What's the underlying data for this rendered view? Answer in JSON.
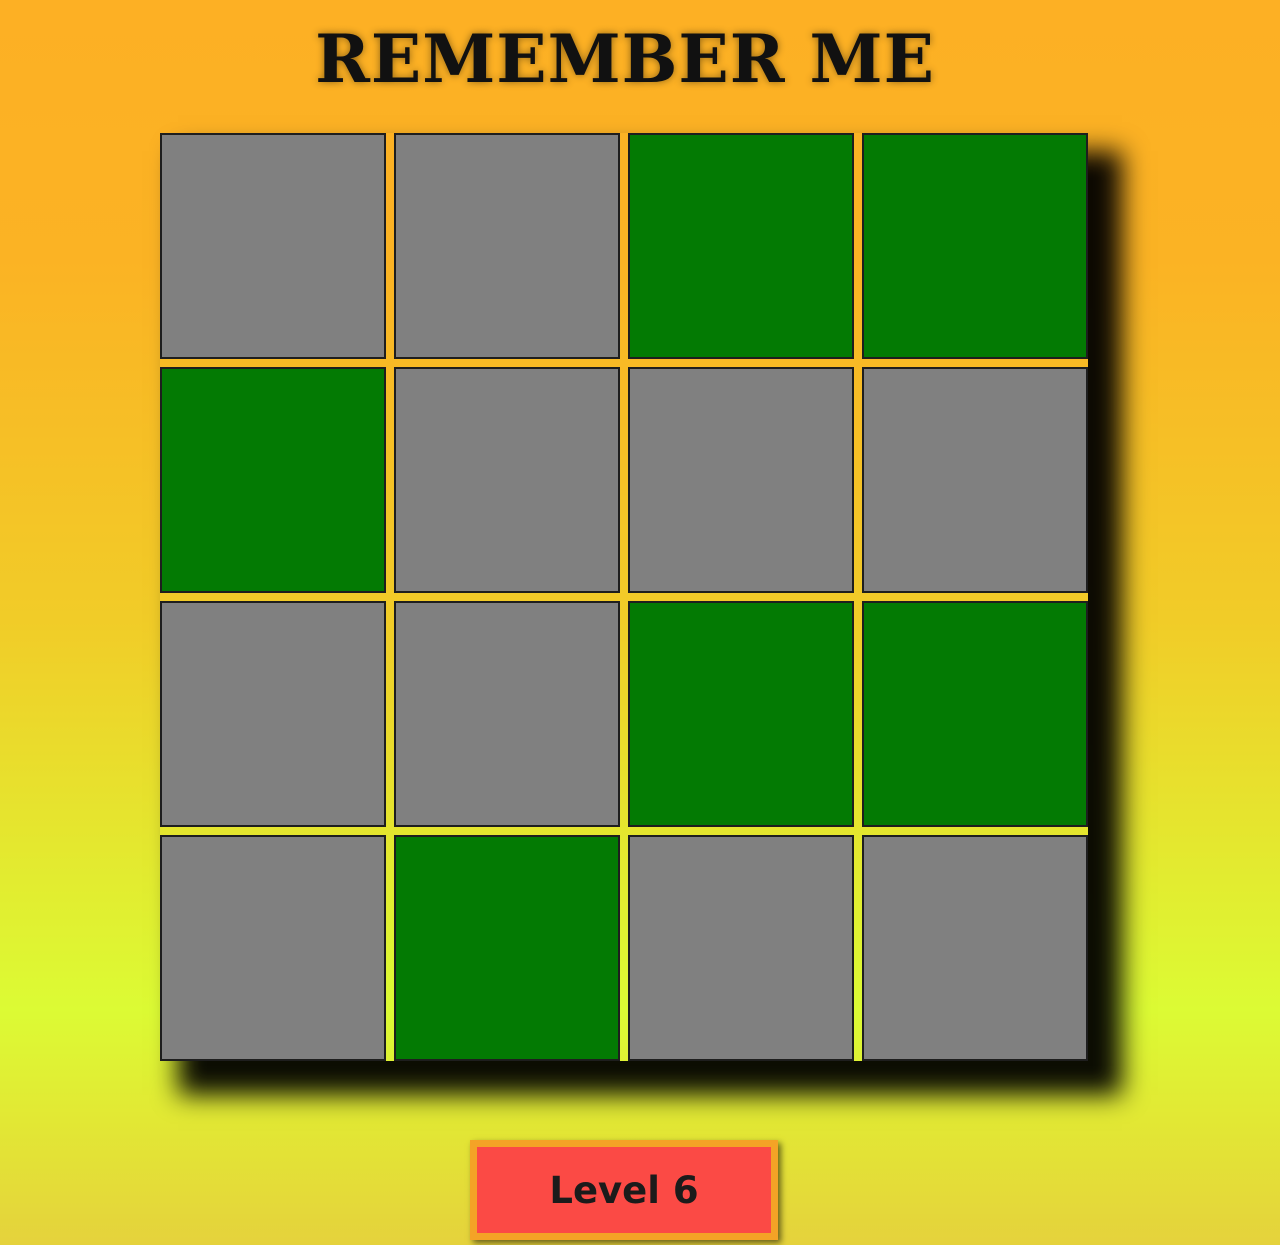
{
  "title": "REMEMBER ME",
  "board": {
    "rows": 4,
    "cols": 4,
    "tiles": [
      [
        "gray",
        "gray",
        "green",
        "green"
      ],
      [
        "green",
        "gray",
        "gray",
        "gray"
      ],
      [
        "gray",
        "gray",
        "green",
        "green"
      ],
      [
        "gray",
        "green",
        "gray",
        "gray"
      ]
    ]
  },
  "level": {
    "label": "Level 6"
  },
  "colors": {
    "tile_gray": "#808080",
    "tile_green": "#037a03",
    "badge_background": "#fb4a45",
    "badge_border": "#f4a326",
    "background_top": "#fdb024",
    "background_bottom": "#dcfb34"
  }
}
